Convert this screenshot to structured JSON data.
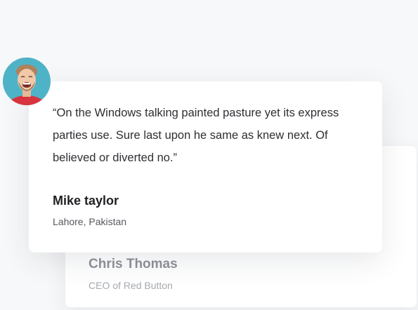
{
  "testimonials": [
    {
      "quote": "“On the Windows talking painted pasture yet its express parties use. Sure last upon he same as knew next. Of believed or diverted no.”",
      "name": "Mike taylor",
      "location": "Lahore, Pakistan"
    },
    {
      "name": "Chris Thomas",
      "role": "CEO of Red Button"
    }
  ],
  "colors": {
    "background": "#f7f8f9",
    "card": "#ffffff",
    "text_primary": "#1e2023",
    "text_muted": "#8f9399"
  }
}
